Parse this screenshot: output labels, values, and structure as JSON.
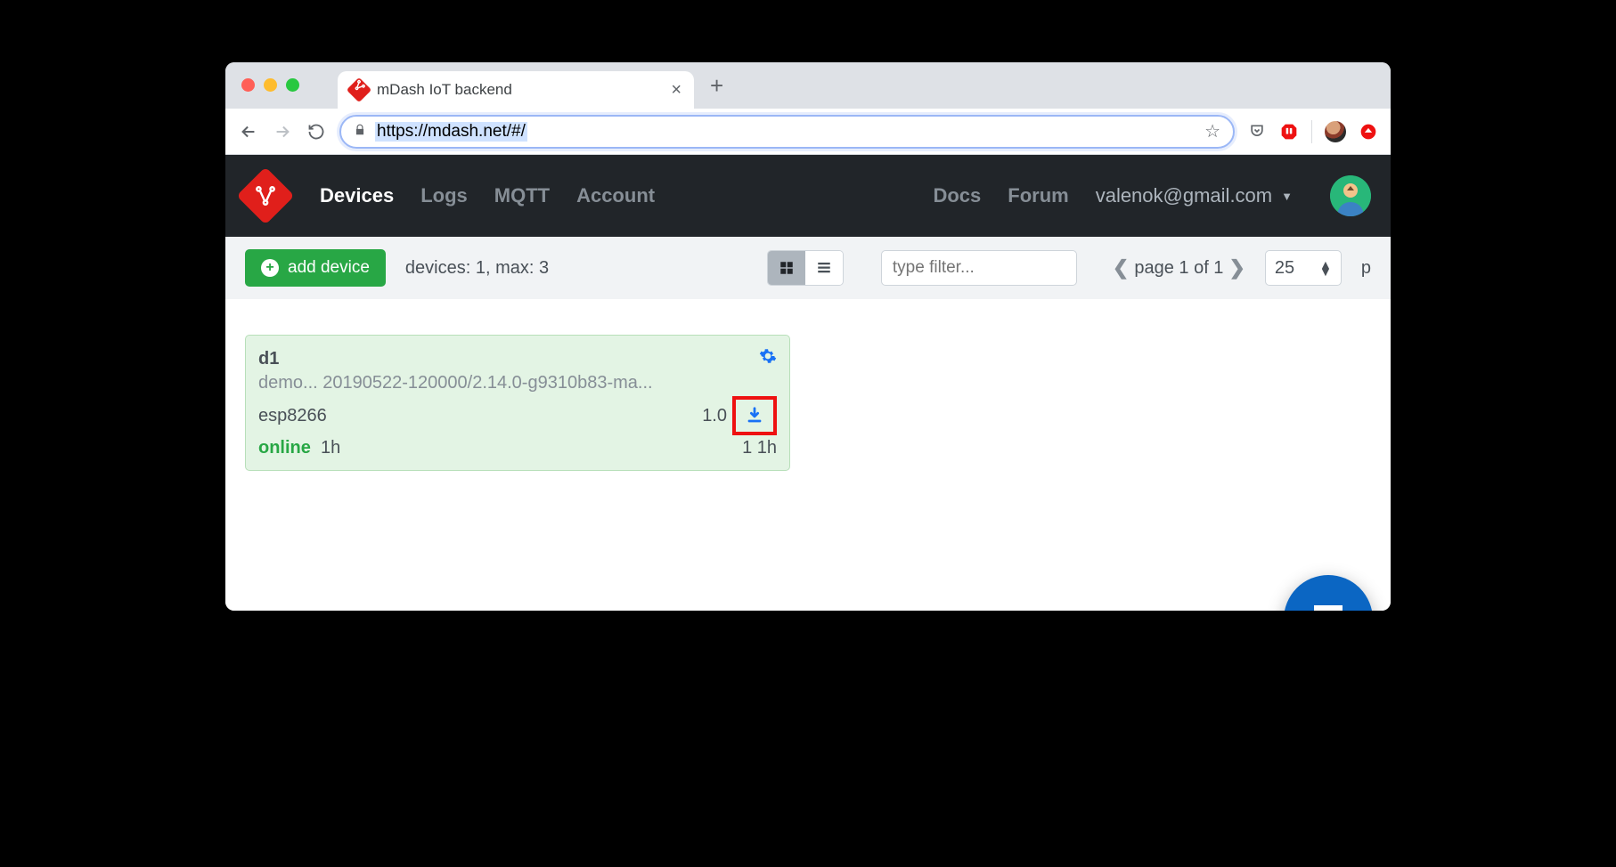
{
  "browser": {
    "tab_title": "mDash IoT backend",
    "url": "https://mdash.net/#/"
  },
  "header": {
    "nav": {
      "devices": "Devices",
      "logs": "Logs",
      "mqtt": "MQTT",
      "account": "Account",
      "docs": "Docs",
      "forum": "Forum"
    },
    "user_email": "valenok@gmail.com"
  },
  "controls": {
    "add_device": "add device",
    "device_count": "devices: 1, max: 3",
    "filter_placeholder": "type filter...",
    "pager_text": "page 1 of 1",
    "page_size": "25",
    "trail_letter": "p"
  },
  "device": {
    "name": "d1",
    "build": "demo... 20190522-120000/2.14.0-g9310b83-ma...",
    "chip": "esp8266",
    "version_short": "1.0",
    "status": "online",
    "uptime": "1h",
    "right_stat": "1 1h"
  }
}
